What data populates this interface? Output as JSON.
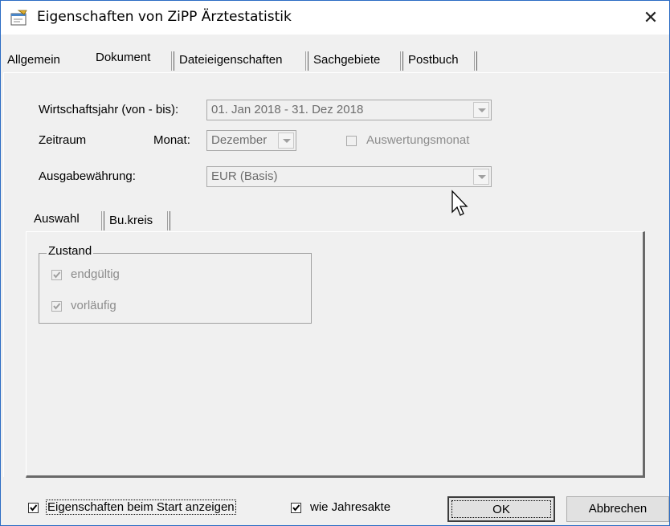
{
  "window": {
    "title": "Eigenschaften von ZiPP Ärztestatistik",
    "close_glyph": "✕"
  },
  "main_tabs": [
    {
      "label": "Allgemein"
    },
    {
      "label": "Dokument"
    },
    {
      "label": "Dateieigenschaften"
    },
    {
      "label": "Sachgebiete"
    },
    {
      "label": "Postbuch"
    }
  ],
  "form": {
    "wirtschaftsjahr_label": "Wirtschaftsjahr (von - bis):",
    "wirtschaftsjahr_value": "01. Jan 2018  -  31. Dez 2018",
    "zeitraum_label": "Zeitraum",
    "monat_label": "Monat:",
    "monat_value": "Dezember",
    "auswertungsmonat_label": "Auswertungsmonat",
    "ausgabewaehrung_label": "Ausgabewährung:",
    "ausgabewaehrung_value": "EUR (Basis)"
  },
  "sub_tabs": [
    {
      "label": "Auswahl"
    },
    {
      "label": "Bu.kreis"
    }
  ],
  "zustand": {
    "title": "Zustand",
    "options": [
      {
        "label": "endgültig",
        "checked": true
      },
      {
        "label": "vorläufig",
        "checked": true
      }
    ]
  },
  "footer": {
    "show_on_start_label": "Eigenschaften beim Start anzeigen",
    "show_on_start_checked": true,
    "wie_jahresakte_label": "wie Jahresakte",
    "wie_jahresakte_checked": true,
    "ok_label": "OK",
    "cancel_label": "Abbrechen"
  }
}
